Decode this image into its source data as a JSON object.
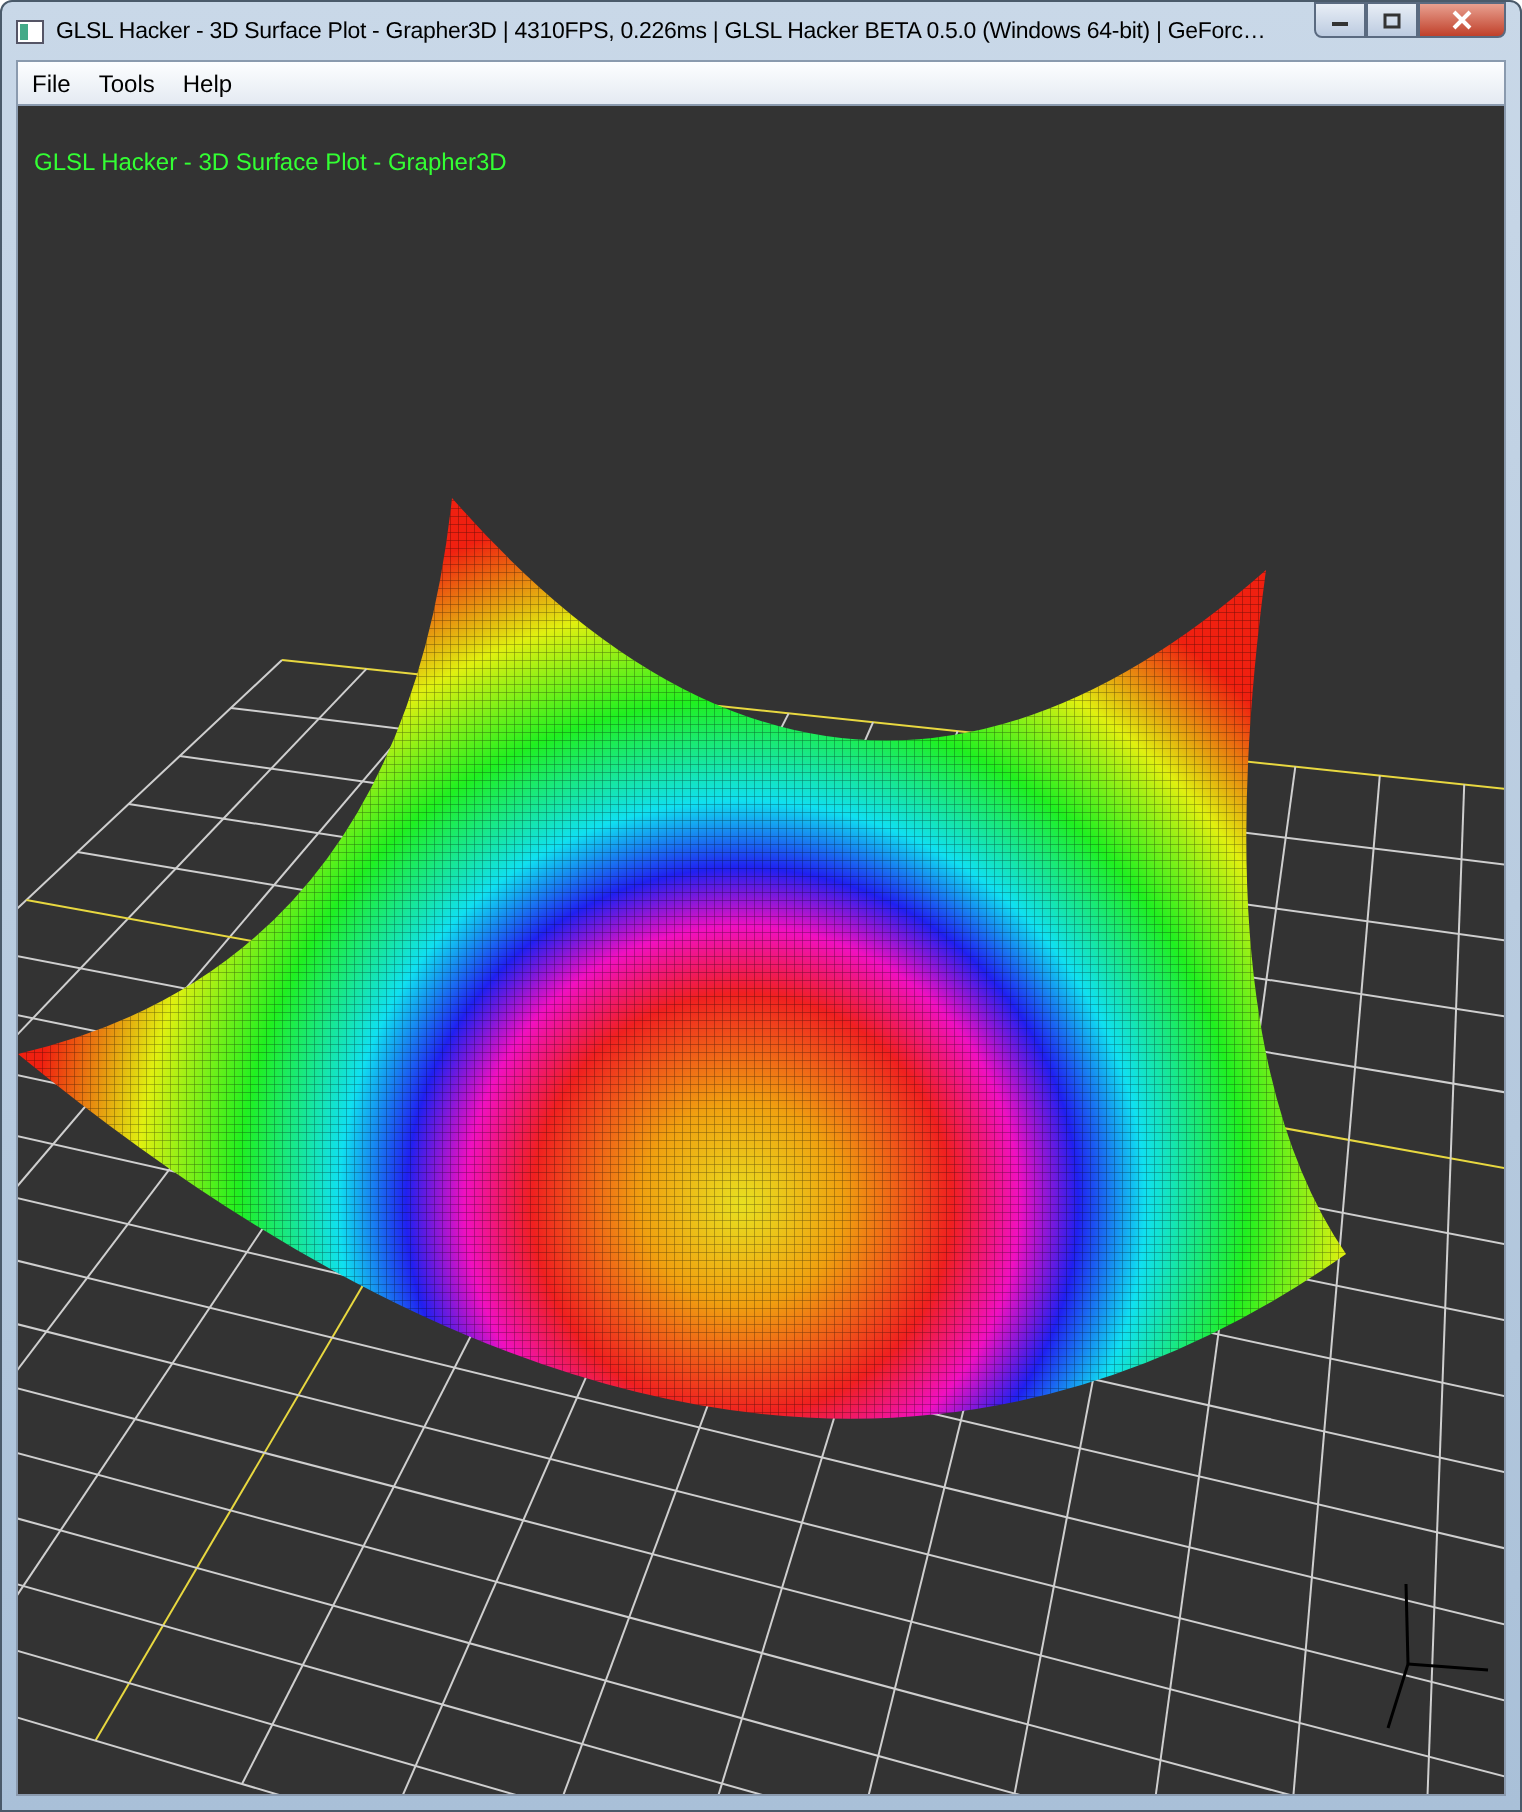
{
  "window": {
    "title": "GLSL Hacker - 3D Surface Plot - Grapher3D | 4310FPS, 0.226ms | GLSL Hacker BETA 0.5.0 (Windows 64-bit) | GeForc…"
  },
  "menu": [
    "File",
    "Tools",
    "Help"
  ],
  "viewport": {
    "overlay_text": "GLSL Hacker - 3D Surface Plot - Grapher3D"
  }
}
